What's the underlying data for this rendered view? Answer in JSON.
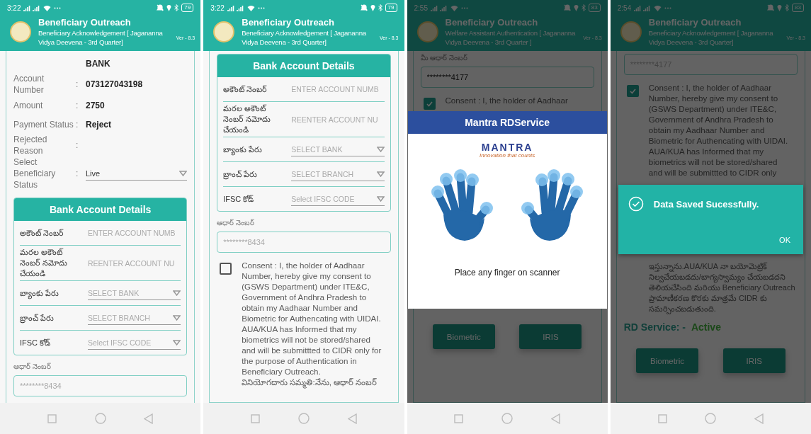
{
  "phones": [
    {
      "status_bar": {
        "time": "3:22",
        "battery": "79"
      },
      "header": {
        "title": "Beneficiary Outreach",
        "subtitle": "Beneficiary Acknowledgement [ Jagananna Vidya Deevena - 3rd Quarter]",
        "version": "Ver - 8.3"
      },
      "dimmed": false,
      "sections": [
        {
          "kind": "details",
          "separator": ":",
          "rows": [
            {
              "kind": "text",
              "value": "BANK"
            },
            {
              "kind": "text",
              "label": "Account Number",
              "value": "073127043198"
            },
            {
              "kind": "text",
              "label": "Amount",
              "value": "2750"
            },
            {
              "kind": "text",
              "label": "Payment Status",
              "value": "Reject"
            },
            {
              "kind": "text",
              "label": "Rejected Reason"
            },
            {
              "kind": "select",
              "label": "Select Beneficiary Status",
              "value": "Live"
            }
          ]
        },
        {
          "kind": "bank",
          "title": "Bank Account Details",
          "fields": [
            {
              "kind": "input",
              "label": "అకౌంట్ నెంబర్",
              "placeholder": "ENTER ACCOUNT NUMB"
            },
            {
              "kind": "input",
              "label": "మరల అకౌంట్ నెంబర్ నమోదు చేయండి",
              "placeholder": "REENTER ACCOUNT NU"
            },
            {
              "kind": "select",
              "label": "బ్యాంకు పేరు",
              "placeholder": "SELECT BANK"
            },
            {
              "kind": "select",
              "label": "బ్రాంచ్ పేరు",
              "placeholder": "SELECT BRANCH"
            },
            {
              "kind": "select",
              "label": "IFSC కోడ్",
              "placeholder": "Select IFSC CODE"
            }
          ]
        },
        {
          "kind": "aadhaar",
          "label": "ఆధార్ నెంబర్",
          "placeholder": "********8434"
        }
      ]
    },
    {
      "status_bar": {
        "time": "3:22",
        "battery": "79"
      },
      "header": {
        "title": "Beneficiary Outreach",
        "subtitle": "Beneficiary Acknowledgement [ Jagananna Vidya Deevena - 3rd Quarter]",
        "version": "Ver - 8.3"
      },
      "dimmed": false,
      "sections": [
        {
          "kind": "bank",
          "title": "Bank Account Details",
          "fields": [
            {
              "kind": "input",
              "label": "అకౌంట్ నెంబర్",
              "placeholder": "ENTER ACCOUNT NUMB"
            },
            {
              "kind": "input",
              "label": "మరల అకౌంట్ నెంబర్ నమోదు చేయండి",
              "placeholder": "REENTER ACCOUNT NU"
            },
            {
              "kind": "select",
              "label": "బ్యాంకు పేరు",
              "placeholder": "SELECT BANK"
            },
            {
              "kind": "select",
              "label": "బ్రాంచ్ పేరు",
              "placeholder": "SELECT BRANCH"
            },
            {
              "kind": "select",
              "label": "IFSC కోడ్",
              "placeholder": "Select IFSC CODE"
            }
          ]
        },
        {
          "kind": "aadhaar",
          "label": "ఆధార్ నెంబర్",
          "placeholder": "********8434"
        },
        {
          "kind": "consent",
          "checked": false,
          "text": "Consent : I, the holder of Aadhaar Number, hereby give my consent to (GSWS Department) under ITE&C, Government of Andhra Pradesh to obtain my Aadhaar Number and Biometric for Authencating with UIDAI. AUA/KUA has Informed that my biometrics will not be stored/shared and will be submittted to CIDR only for the purpose of Authentication in Beneficiary Outreach.",
          "text_telugu": "వినియోగదారు సమ్మతి:నేను, ఆధార్ నంబర్"
        }
      ]
    },
    {
      "status_bar": {
        "time": "2:55",
        "battery": "83"
      },
      "header": {
        "title": "Beneficiary Outreach",
        "subtitle": "Welfare Assistant Authentication [ Jagananna Vidya Deevena - 3rd Quarter ]",
        "version": "Ver - 8.3"
      },
      "dimmed": true,
      "sections": [
        {
          "kind": "aadhaar",
          "label": "మీ ఆధార్ నెంబర్",
          "value": "********4177"
        },
        {
          "kind": "consent",
          "checked": true,
          "text": "Consent : I, the holder of Aadhaar"
        },
        {
          "kind": "scanner_dialog",
          "title": "Mantra RDService",
          "logo": "MANTRA",
          "tagline": "Innovation that counts",
          "message": "Place any finger on scanner"
        },
        {
          "kind": "buttons",
          "buttons": [
            "Biometric",
            "IRIS"
          ]
        }
      ]
    },
    {
      "status_bar": {
        "time": "2:54",
        "battery": "83"
      },
      "header": {
        "title": "Beneficiary Outreach",
        "subtitle": "Beneficiary Acknowledgement [ Jagananna Vidya Deevena - 3rd Quarter]",
        "version": "Ver - 8.3"
      },
      "dimmed": true,
      "sections": [
        {
          "kind": "aadhaar",
          "placeholder": "********4177"
        },
        {
          "kind": "consent",
          "checked": true,
          "text": "Consent : I, the holder of Aadhaar Number, hereby give my consent to (GSWS Department) under ITE&C, Government of Andhra Pradesh to obtain my Aadhaar Number and Biometric for Authencating with UIDAI. AUA/KUA has Informed that my biometrics will not be stored/shared and will be submittted to CIDR only"
        },
        {
          "kind": "alert_dialog",
          "message": "Data Saved Sucessfully.",
          "action": "OK"
        },
        {
          "kind": "consent_tail",
          "text": "ఇస్తున్నాను.AUA/KUA నా బయోమెట్రిక్ నిల్వచేయబడదు/బాగ్యస్వామ్యం చేయబడదని తెలియచేసింది మరియు Beneficiary Outreach ప్రామాణీకరణ కొరకు మాత్రమే CIDR కు సమర్పించబడుతుంది."
        },
        {
          "kind": "rd_service",
          "label": "RD Service: -",
          "status": "Active"
        },
        {
          "kind": "buttons",
          "buttons": [
            "Biometric",
            "IRIS"
          ]
        }
      ]
    }
  ]
}
